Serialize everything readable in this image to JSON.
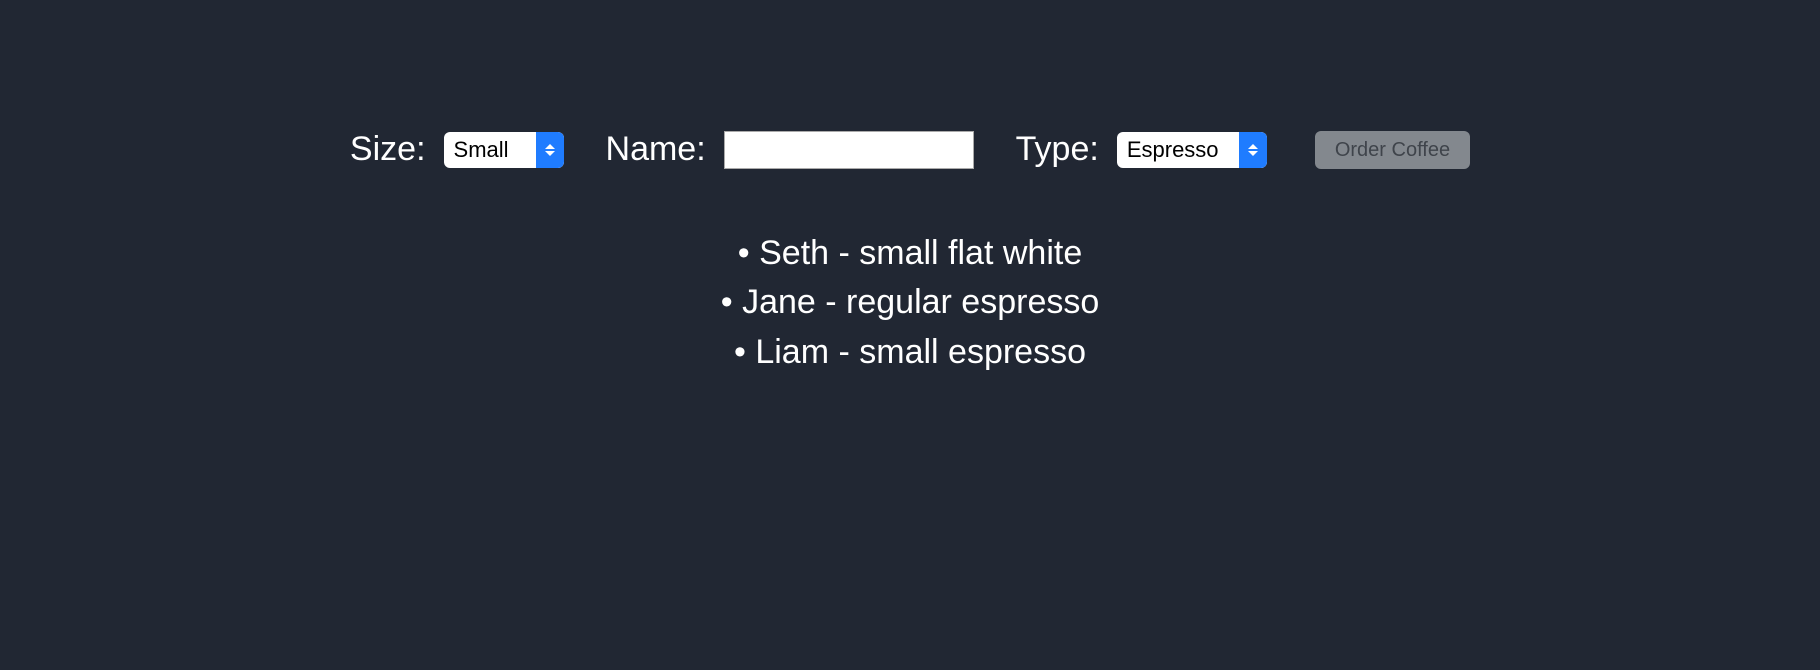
{
  "form": {
    "size_label": "Size:",
    "size_value": "Small",
    "name_label": "Name:",
    "name_value": "",
    "type_label": "Type:",
    "type_value": "Espresso",
    "button_label": "Order Coffee"
  },
  "orders": [
    "Seth - small flat white",
    "Jane - regular espresso",
    "Liam - small espresso"
  ]
}
